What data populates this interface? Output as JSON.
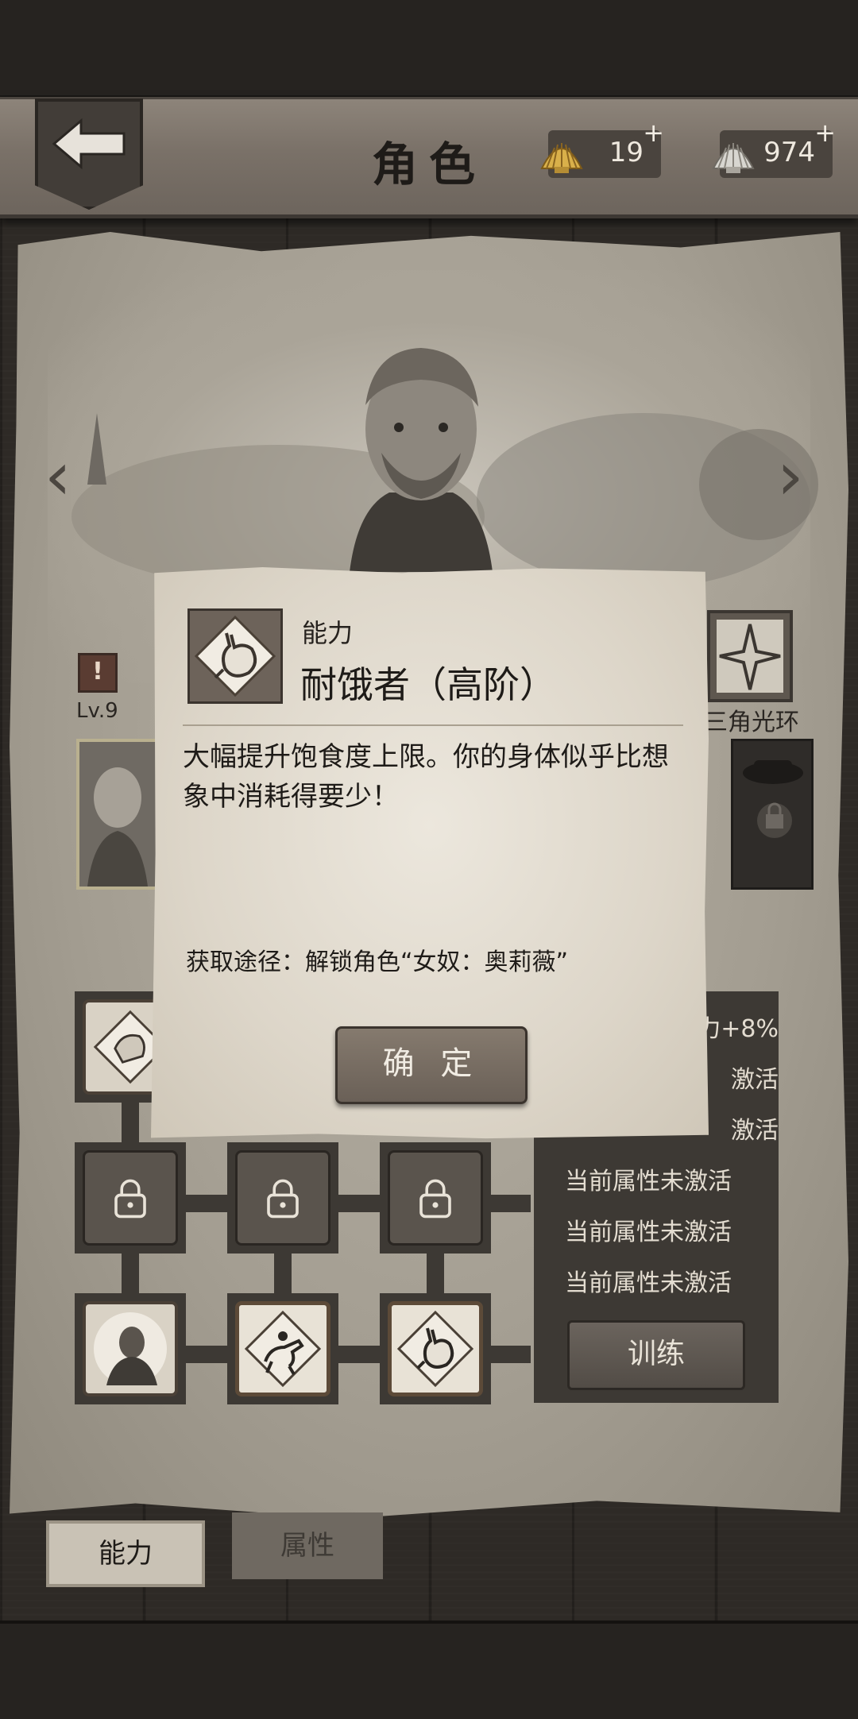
{
  "header": {
    "title": "角色",
    "currencies": [
      {
        "icon": "gold-shell-icon",
        "value": "19",
        "add_label": "+"
      },
      {
        "icon": "silver-shell-icon",
        "value": "974",
        "add_label": "+"
      }
    ]
  },
  "character": {
    "alert_mark": "!",
    "level": "Lv.9",
    "halo_label": "三角光环"
  },
  "attributes": {
    "first_visible_bonus": "力+8%",
    "inactive_partial": "激活",
    "inactive_lines": [
      "当前属性未激活",
      "当前属性未激活",
      "当前属性未激活"
    ],
    "train_label": "训练"
  },
  "tabs": [
    {
      "label": "能力",
      "active": true
    },
    {
      "label": "属性",
      "active": false
    }
  ],
  "modal": {
    "category": "能力",
    "title": "耐饿者（高阶）",
    "description": "大幅提升饱食度上限。你的身体似乎比想象中消耗得要少！",
    "source": "获取途径：解锁角色“女奴：奥莉薇”",
    "confirm_label": "确 定",
    "icon": "stomach-icon"
  },
  "colors": {
    "parchment": "#ece7dd",
    "wood": "#7a7168",
    "panel": "#3d3934"
  }
}
